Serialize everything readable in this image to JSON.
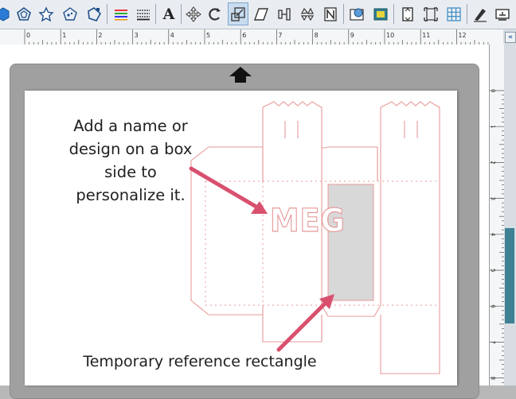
{
  "toolbar": {
    "tools": [
      {
        "name": "draw-tool-icon"
      },
      {
        "name": "polygon-tool-icon"
      },
      {
        "name": "star-tool-icon"
      },
      {
        "name": "pentagon-edit-icon"
      },
      {
        "name": "curve-tool-icon"
      },
      {
        "name": "line-color-icon"
      },
      {
        "name": "line-style-icon"
      },
      {
        "name": "text-tool-icon"
      },
      {
        "name": "move-tool-icon"
      },
      {
        "name": "rotate-tool-icon"
      },
      {
        "name": "scale-tool-icon"
      },
      {
        "name": "shear-tool-icon"
      },
      {
        "name": "align-tool-icon"
      },
      {
        "name": "replicate-tool-icon"
      },
      {
        "name": "nesting-tool-icon"
      },
      {
        "name": "design-store-icon"
      },
      {
        "name": "fill-color-icon"
      },
      {
        "name": "page-setup-icon"
      },
      {
        "name": "fit-page-icon"
      },
      {
        "name": "grid-icon"
      },
      {
        "name": "knife-tool-icon"
      },
      {
        "name": "send-to-cutter-icon"
      }
    ],
    "text_tool_glyph": "A"
  },
  "ruler": {
    "labels": [
      "0",
      "1",
      "2",
      "3",
      "4",
      "5",
      "6",
      "7",
      "8",
      "9",
      "10",
      "11",
      "12"
    ],
    "v_labels": [
      "0",
      "1",
      "2",
      "3",
      "4",
      "5",
      "6",
      "7",
      "8"
    ]
  },
  "canvas": {
    "callout_top": "Add a name or design on a box side to personalize it.",
    "callout_bottom": "Temporary reference rectangle",
    "monogram": "MEG"
  },
  "colors": {
    "cut_line": "#e89a9a",
    "arrow": "#d9506f",
    "reference_rect": "#d8d8d8",
    "panel_tab": "#3f8194",
    "mat": "#a0a0a0"
  }
}
